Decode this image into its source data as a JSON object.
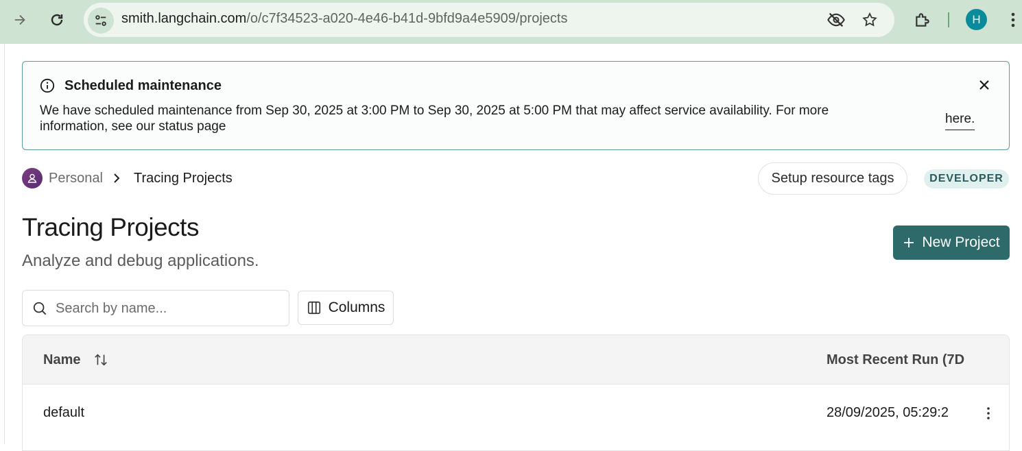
{
  "browser": {
    "url_host": "smith.langchain.com",
    "url_path": "/o/c7f34523-a020-4e46-b41d-9bfd9a4e5909/projects",
    "profile_initial": "H"
  },
  "banner": {
    "title": "Scheduled maintenance",
    "text": "We have scheduled maintenance from Sep 30, 2025 at 3:00 PM to Sep 30, 2025 at 5:00 PM that may affect service availability. For more information, see our status page",
    "link_label": "here."
  },
  "breadcrumb": {
    "workspace": "Personal",
    "current": "Tracing Projects"
  },
  "header_actions": {
    "tags_button": "Setup resource tags",
    "badge": "DEVELOPER"
  },
  "page": {
    "title": "Tracing Projects",
    "subtitle": "Analyze and debug applications.",
    "new_button": "New Project"
  },
  "toolbar": {
    "search_placeholder": "Search by name...",
    "columns_button": "Columns"
  },
  "table": {
    "columns": [
      "Name",
      "Most Recent Run (7D"
    ],
    "rows": [
      {
        "name": "default",
        "most_recent_run": "28/09/2025, 05:29:2"
      }
    ]
  },
  "colors": {
    "chrome": "#cfe3d3",
    "accent": "#2e6a6a",
    "banner_border": "#5e9a9a"
  }
}
